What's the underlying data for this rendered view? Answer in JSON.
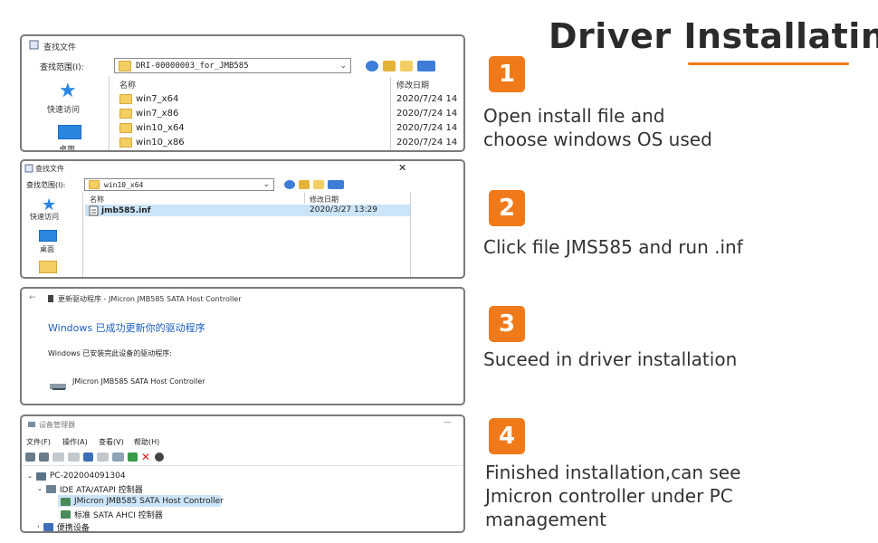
{
  "header": {
    "title": "Driver Installatin"
  },
  "steps": [
    {
      "number": "1",
      "text": "Open install file and\nchoose windows OS used"
    },
    {
      "number": "2",
      "text": "Click file JMS585 and run .inf"
    },
    {
      "number": "3",
      "text": "Suceed in driver installation"
    },
    {
      "number": "4",
      "text": "Finished installation,can see\nJmicron controller under PC\nmanagement"
    }
  ],
  "shot1": {
    "window_title": "查找文件",
    "look_in_label": "查找范围(I):",
    "path": "DRI-00000003_for_JMB585",
    "quick_access": "快速访问",
    "desktop": "桌面",
    "col_name": "名称",
    "col_date": "修改日期",
    "rows": [
      {
        "name": "win7_x64",
        "date": "2020/7/24 14"
      },
      {
        "name": "win7_x86",
        "date": "2020/7/24 14"
      },
      {
        "name": "win10_x64",
        "date": "2020/7/24 14"
      },
      {
        "name": "win10_x86",
        "date": "2020/7/24 14"
      }
    ]
  },
  "shot2": {
    "window_title": "查找文件",
    "close": "✕",
    "look_in_label": "查找范围(I):",
    "path": "win10_x64",
    "quick_access": "快速访问",
    "desktop": "桌面",
    "col_name": "名称",
    "col_date": "修改日期",
    "file_name": "jmb585.inf",
    "file_date": "2020/3/27 13:29"
  },
  "shot3": {
    "back_arrow": "←",
    "window_title": "更新驱动程序 - JMicron JMB585 SATA Host Controller",
    "headline": "Windows 已成功更新你的驱动程序",
    "subline": "Windows 已安装完此设备的驱动程序:",
    "device": "JMicron JMB585 SATA Host Controller"
  },
  "shot4": {
    "window_title": "设备管理器",
    "minimize": "—",
    "menu": [
      "文件(F)",
      "操作(A)",
      "查看(V)",
      "帮助(H)"
    ],
    "tree": {
      "root": "PC-202004091304",
      "ide": "IDE ATA/ATAPI 控制器",
      "jmicron": "JMicron JMB585 SATA Host Controller",
      "ahci": "标准 SATA AHCI 控制器",
      "portable": "便携设备"
    }
  },
  "colors": {
    "accent": "#f07a1a",
    "text": "#333333",
    "frame": "#7b7b7b",
    "link_blue": "#1f5fbf"
  }
}
